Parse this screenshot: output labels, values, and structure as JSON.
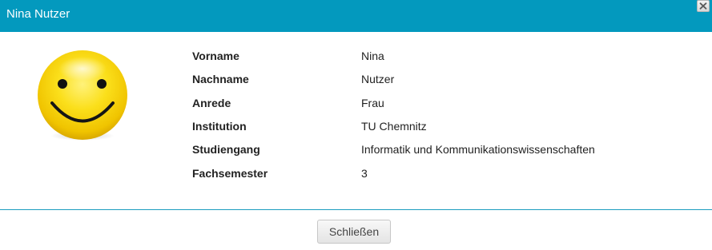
{
  "dialog": {
    "title": "Nina Nutzer",
    "close_label": "close"
  },
  "colors": {
    "titlebar": "#0399be",
    "divider": "#1c9dbf",
    "smiley_face": "#f6d500"
  },
  "avatar": {
    "icon": "smiley-face-icon"
  },
  "profile": [
    {
      "label": "Vorname",
      "value": "Nina"
    },
    {
      "label": "Nachname",
      "value": "Nutzer"
    },
    {
      "label": "Anrede",
      "value": "Frau"
    },
    {
      "label": "Institution",
      "value": "TU Chemnitz"
    },
    {
      "label": "Studiengang",
      "value": "Informatik und Kommunikationswissenschaften"
    },
    {
      "label": "Fachsemester",
      "value": "3"
    }
  ],
  "footer": {
    "close_button_label": "Schließen"
  }
}
